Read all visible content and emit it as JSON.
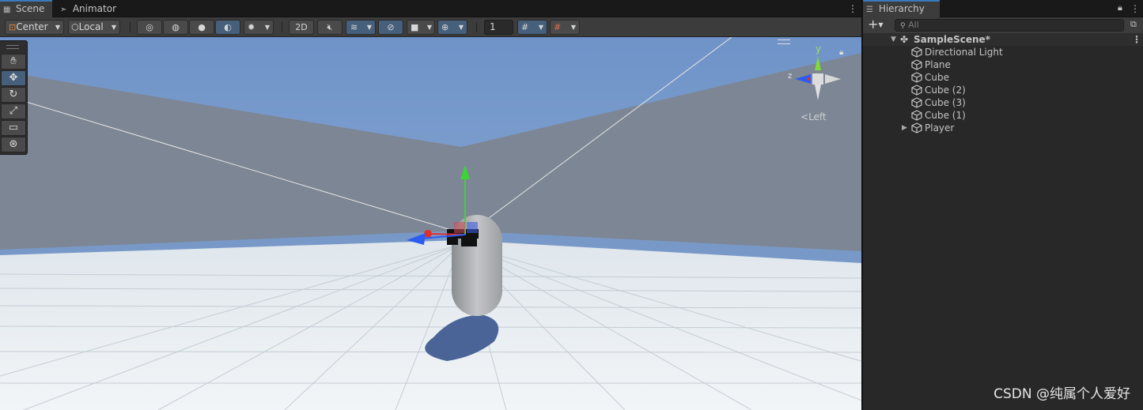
{
  "scene_window": {
    "tabs": [
      {
        "label": "Scene",
        "icon": "grid-icon",
        "active": true
      },
      {
        "label": "Animator",
        "icon": "animator-icon",
        "active": false
      }
    ],
    "toolbar": {
      "pivot_label": "Center",
      "space_label": "Local",
      "mode_2d_label": "2D",
      "grid_snap_value": "1"
    },
    "tools": [
      "hand-tool",
      "move-tool",
      "rotate-tool",
      "scale-tool",
      "rect-tool",
      "transform-tool"
    ],
    "gizmo": {
      "y_label": "y",
      "z_label": "z",
      "view_label": "Left"
    }
  },
  "hierarchy": {
    "tab_label": "Hierarchy",
    "search_placeholder": "All",
    "scene_name": "SampleScene*",
    "items": [
      {
        "label": "Directional Light",
        "expandable": false
      },
      {
        "label": "Plane",
        "expandable": false
      },
      {
        "label": "Cube",
        "expandable": false
      },
      {
        "label": "Cube (2)",
        "expandable": false
      },
      {
        "label": "Cube (3)",
        "expandable": false
      },
      {
        "label": "Cube (1)",
        "expandable": false
      },
      {
        "label": "Player",
        "expandable": true
      }
    ]
  },
  "watermark": "CSDN @纯属个人爱好",
  "colors": {
    "accent": "#46607c",
    "sky": "#7f9fce",
    "wall": "#7c8594",
    "floor": "#e6ebef",
    "axis_x": "#e0302a",
    "axis_y": "#3fd23a",
    "axis_z": "#2d5cf0"
  }
}
